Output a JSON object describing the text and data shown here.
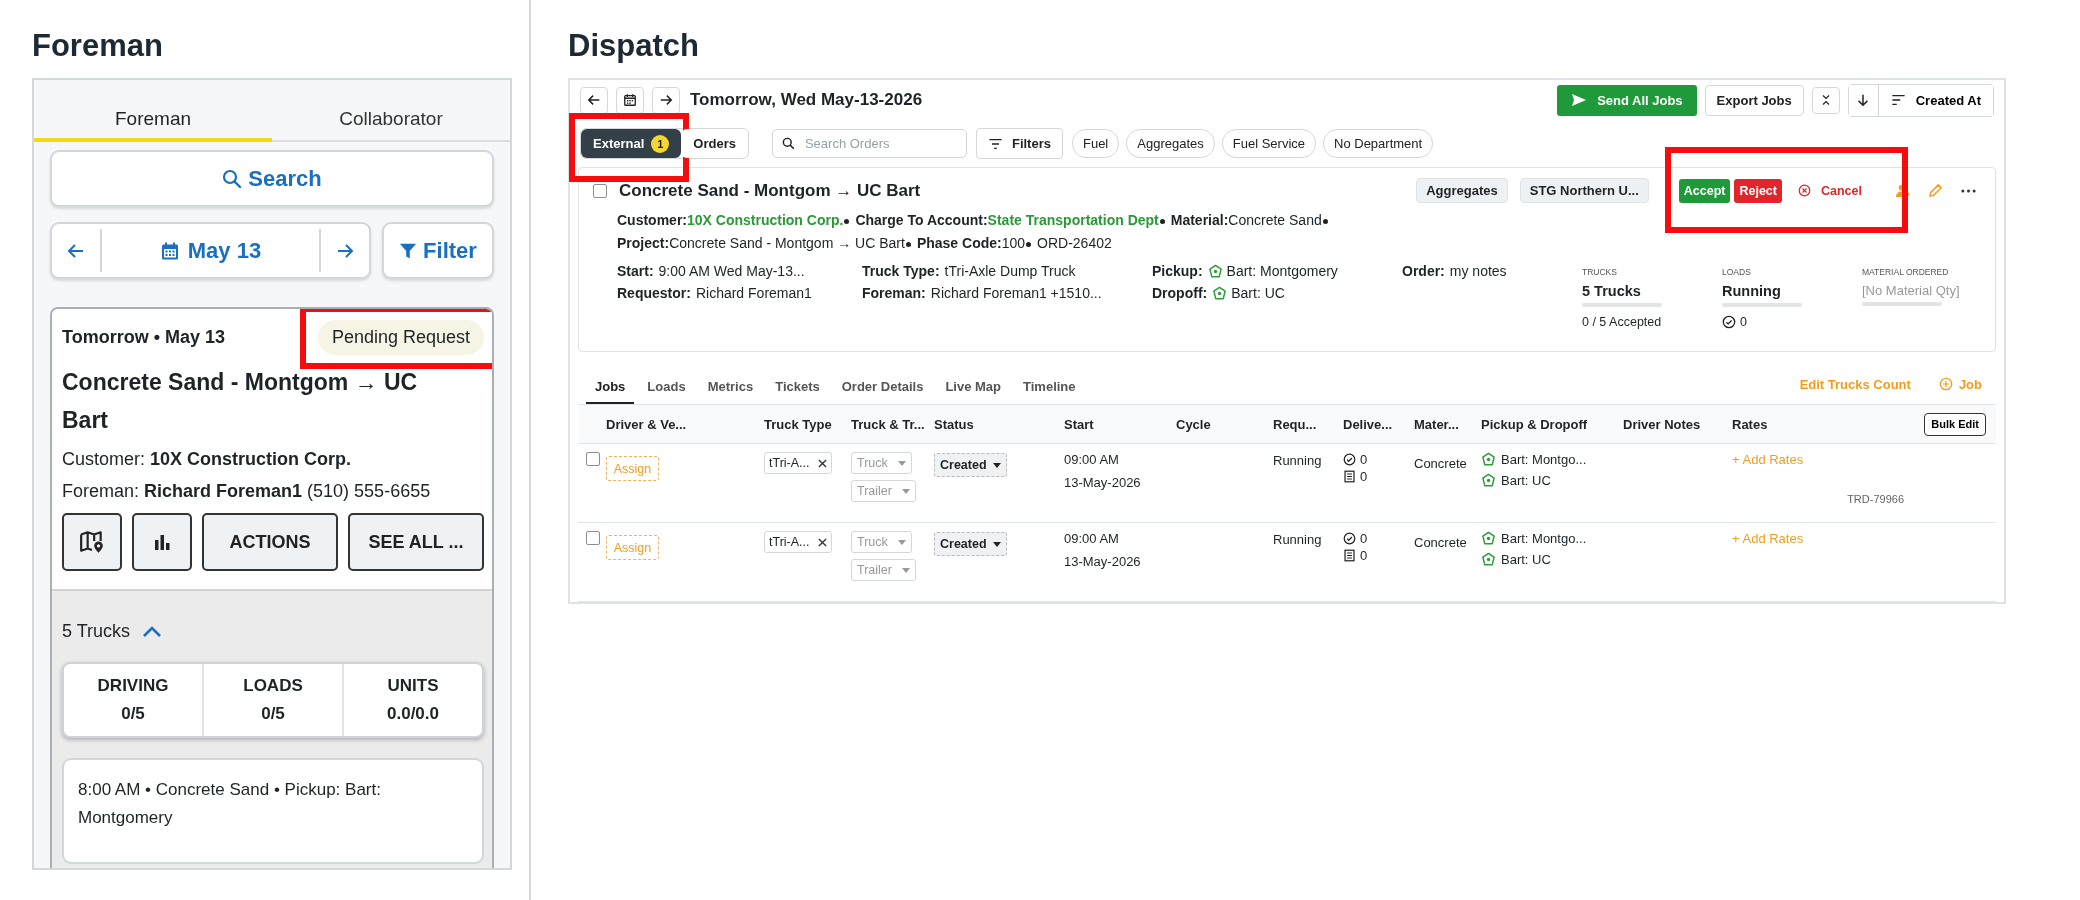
{
  "foreman": {
    "heading": "Foreman",
    "tabs": [
      {
        "label": "Foreman",
        "selected": true
      },
      {
        "label": "Collaborator",
        "selected": false
      }
    ],
    "search_button": "Search",
    "date": "May 13",
    "filter_button": "Filter",
    "job": {
      "date": "Tomorrow • May 13",
      "status": "Pending Request",
      "status_highlighted": true,
      "title": "Concrete Sand - Montgom → UC Bart",
      "customer": "Customer: **10X Construction Corp.**",
      "foreman": "Foreman: **Richard Foreman1** (510) 555-6655",
      "actions_button": "ACTIONS",
      "see_all_button": "SEE ALL ...",
      "trucks": "5 Trucks",
      "trucks_expanded": true,
      "stats": [
        {
          "label": "DRIVING",
          "value": "0/5"
        },
        {
          "label": "LOADS",
          "value": "0/5"
        },
        {
          "label": "UNITS",
          "value": "0.0/0.0"
        }
      ],
      "entries": [
        "8:00 AM • Concrete Sand • Pickup: Bart: Montgomery"
      ]
    }
  },
  "dispatch": {
    "heading": "Dispatch",
    "date": "Tomorrow, Wed May-13-2026",
    "send_button": "Send All Jobs",
    "export_button": "Export Jobs",
    "sort": "Created At",
    "views": [
      {
        "label": "External",
        "badge": "1",
        "selected": true,
        "highlighted": true
      },
      {
        "label": "Orders",
        "selected": false,
        "highlighted": false
      }
    ],
    "search": {
      "placeholder": "Search Orders"
    },
    "filters_button": "Filters",
    "chips": [
      "Fuel",
      "Aggregates",
      "Fuel Service",
      "No Department"
    ],
    "order": {
      "checked": false,
      "title": "Concrete Sand - Montgom → UC Bart",
      "meta": [
        {
          "label": "Customer:",
          "value": "10X Construction Corp.",
          "kind": "link"
        },
        {
          "label": "Charge To Account:",
          "value": "State Transportation Dept",
          "kind": "link"
        },
        {
          "label": "Material:",
          "value": "Concrete Sand",
          "kind": "text"
        },
        {
          "label": "Project:",
          "value": "Concrete Sand - Montgom → UC Bart",
          "kind": "text"
        },
        {
          "label": "Phase Code:",
          "value": "100",
          "kind": "text"
        },
        {
          "value": "ORD-26402",
          "kind": "text"
        }
      ],
      "tags": [
        "Aggregates",
        "STG Northern U..."
      ],
      "accept_button": "Accept",
      "reject_button": "Reject",
      "cancel_button": "Cancel",
      "actions_highlighted": true,
      "info": [
        {
          "label": "Start:",
          "value": "9:00 AM Wed May-13...",
          "kind": "text"
        },
        {
          "label": "Truck Type:",
          "value": "tTri-Axle Dump Truck",
          "kind": "text"
        },
        {
          "label": "Pickup:",
          "value": "Bart: Montgomery",
          "kind": "place"
        },
        {
          "label": "Order:",
          "value": "my notes",
          "kind": "text"
        },
        {
          "label": "Requestor:",
          "value": "Richard Foreman1",
          "kind": "text"
        },
        {
          "label": "Foreman:",
          "value": "Richard Foreman1 +1510...",
          "kind": "text"
        },
        {
          "label": "Dropoff:",
          "value": "Bart: UC",
          "kind": "place"
        }
      ],
      "stats": [
        {
          "label": "TRUCKS",
          "value": "5 Trucks",
          "level": 0,
          "note": "0 / 5 Accepted",
          "kind": "text"
        },
        {
          "label": "LOADS",
          "value": "Running",
          "level": 0,
          "note": "0",
          "kind": "check"
        },
        {
          "label": "MATERIAL ORDERED",
          "value": "[No Material Qty]",
          "level": 0,
          "kind": "muted"
        }
      ]
    },
    "tabs": [
      {
        "label": "Jobs",
        "selected": true
      },
      {
        "label": "Loads",
        "selected": false
      },
      {
        "label": "Metrics",
        "selected": false
      },
      {
        "label": "Tickets",
        "selected": false
      },
      {
        "label": "Order Details",
        "selected": false
      },
      {
        "label": "Live Map",
        "selected": false
      },
      {
        "label": "Timeline",
        "selected": false
      }
    ],
    "edit_trucks_link": "Edit Trucks Count",
    "add_job_button": "Job",
    "columns": [
      "Driver & Ve...",
      "Truck Type",
      "Truck & Tr...",
      "Status",
      "Start",
      "Cycle",
      "Requ...",
      "Delive...",
      "Mater...",
      "Pickup & Dropoff",
      "Driver Notes",
      "Rates"
    ],
    "bulk_edit_button": "Bulk Edit",
    "rows": [
      {
        "checked": false,
        "assign": "Assign",
        "truck_type": "tTri-A...",
        "truck": "Truck",
        "trailer": "Trailer",
        "status": "Created",
        "time": "09:00 AM",
        "date": "13-May-2026",
        "requested": "Running",
        "delivered_loads": "0",
        "delivered_tickets": "0",
        "material": "Concrete",
        "pickup": "Bart: Montgo...",
        "dropoff": "Bart: UC",
        "rates": "+ Add Rates",
        "id": "TRD-79966"
      },
      {
        "checked": false,
        "assign": "Assign",
        "truck_type": "tTri-A...",
        "truck": "Truck",
        "trailer": "Trailer",
        "status": "Created",
        "time": "09:00 AM",
        "date": "13-May-2026",
        "requested": "Running",
        "delivered_loads": "0",
        "delivered_tickets": "0",
        "material": "Concrete",
        "pickup": "Bart: Montgo...",
        "dropoff": "Bart: UC",
        "rates": "+ Add Rates"
      }
    ]
  }
}
